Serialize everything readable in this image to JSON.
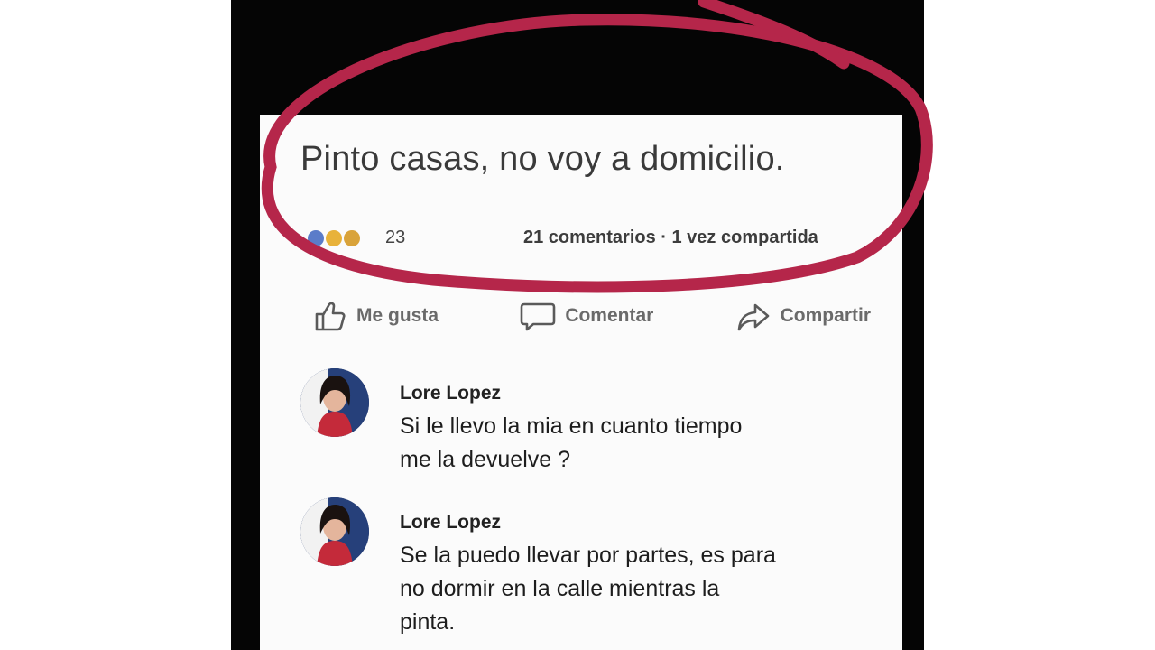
{
  "post": {
    "text": "Pinto casas, no voy a domicilio.",
    "reactions_count": "23",
    "engagement": "21 comentarios · 1 vez compartida"
  },
  "actions": {
    "like": "Me gusta",
    "comment": "Comentar",
    "share": "Compartir"
  },
  "comments": [
    {
      "author": "Lore Lopez",
      "line1": "Si le llevo la mia en cuanto tiempo",
      "line2": "me la devuelve ?"
    },
    {
      "author": "Lore Lopez",
      "line1": "Se la puedo llevar por partes, es para",
      "line2": "no dormir en la calle mientras la",
      "line3": "pinta."
    }
  ],
  "colors": {
    "highlight_circle": "#b5264a",
    "background": "#050505",
    "card": "#fbfbfb"
  }
}
